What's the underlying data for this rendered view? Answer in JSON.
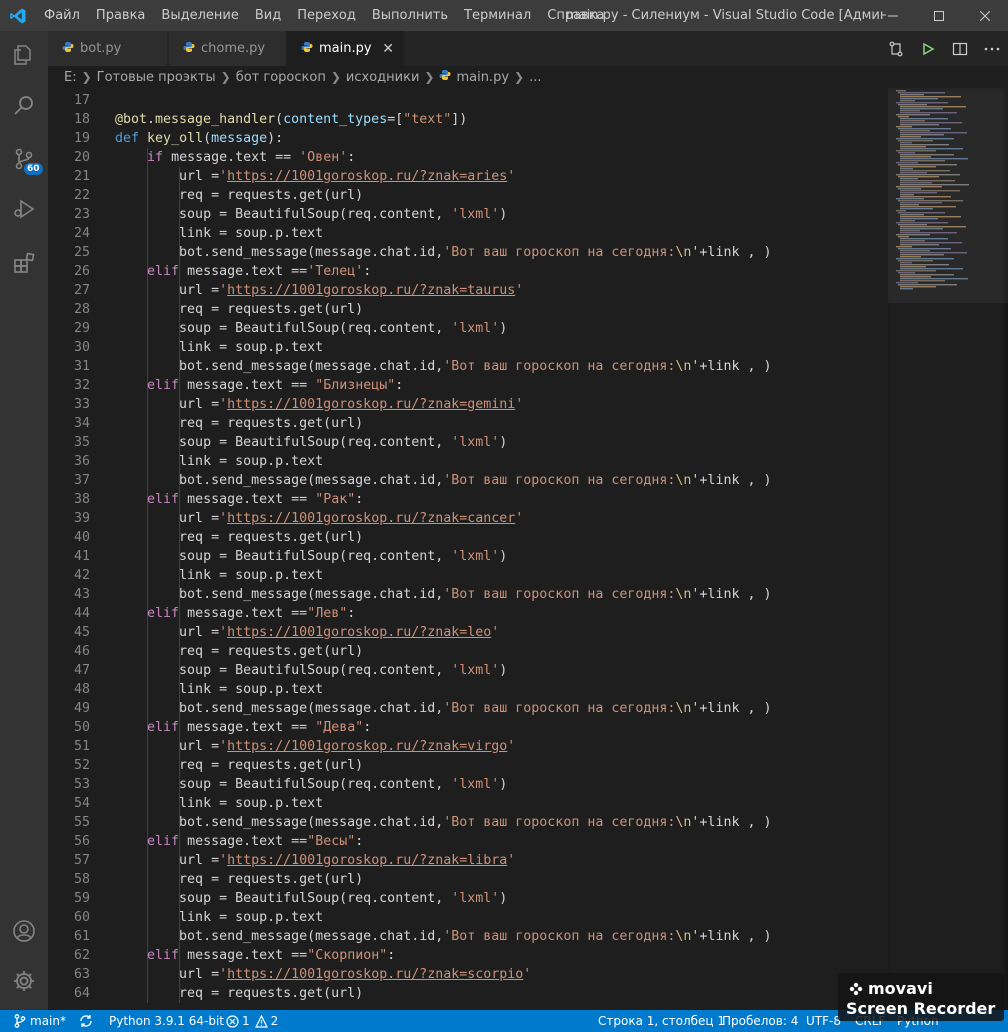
{
  "window": {
    "title": "main.py - Силениум - Visual Studio Code [Администра...",
    "menu": [
      "Файл",
      "Правка",
      "Выделение",
      "Вид",
      "Переход",
      "Выполнить",
      "Терминал",
      "Справка"
    ]
  },
  "activity": {
    "scm_badge": "60"
  },
  "tabs": [
    {
      "label": "bot.py"
    },
    {
      "label": "chome.py"
    },
    {
      "label": "main.py",
      "close": "✕"
    }
  ],
  "breadcrumb": {
    "drive": "E:",
    "folder1": "Готовые проэкты",
    "folder2": "бот гороскоп",
    "folder3": "исходники",
    "file": "main.py",
    "ellipsis": "..."
  },
  "code": {
    "decorator": "@bot.message_handler",
    "decorator_arg": "content_types",
    "decorator_str": "\"text\"",
    "def": "def",
    "funcname": "key_oll",
    "param": "message",
    "if_kw": "if",
    "elif_kw": "elif",
    "cond_prefix": "message.text",
    "url_prefix": "url =",
    "req_line": "req = requests.get(url)",
    "soup_line": "soup = BeautifulSoup(req.content, ",
    "lxml": "'lxml'",
    "link_line": "link = soup.p.text",
    "send_prefix": "bot.send_message(message.chat.id,",
    "send_str": "'Вот ваш гороскоп на сегодня:",
    "send_esc": "\\n",
    "send_tail": "'+link , )",
    "lines": [
      {
        "n": "17"
      },
      {
        "n": "18"
      },
      {
        "n": "19"
      },
      {
        "n": "20"
      },
      {
        "n": "21"
      },
      {
        "n": "22"
      },
      {
        "n": "23"
      },
      {
        "n": "24"
      },
      {
        "n": "25"
      },
      {
        "n": "26"
      },
      {
        "n": "27"
      },
      {
        "n": "28"
      },
      {
        "n": "29"
      },
      {
        "n": "30"
      },
      {
        "n": "31"
      },
      {
        "n": "32"
      },
      {
        "n": "33"
      },
      {
        "n": "34"
      },
      {
        "n": "35"
      },
      {
        "n": "36"
      },
      {
        "n": "37"
      },
      {
        "n": "38"
      },
      {
        "n": "39"
      },
      {
        "n": "40"
      },
      {
        "n": "41"
      },
      {
        "n": "42"
      },
      {
        "n": "43"
      },
      {
        "n": "44"
      },
      {
        "n": "45"
      },
      {
        "n": "46"
      },
      {
        "n": "47"
      },
      {
        "n": "48"
      },
      {
        "n": "49"
      },
      {
        "n": "50"
      },
      {
        "n": "51"
      },
      {
        "n": "52"
      },
      {
        "n": "53"
      },
      {
        "n": "54"
      },
      {
        "n": "55"
      },
      {
        "n": "56"
      },
      {
        "n": "57"
      },
      {
        "n": "58"
      },
      {
        "n": "59"
      },
      {
        "n": "60"
      },
      {
        "n": "61"
      },
      {
        "n": "62"
      },
      {
        "n": "63"
      },
      {
        "n": "64"
      }
    ],
    "blocks": [
      {
        "op": " == ",
        "sign": "'Овен'",
        "url": "https://1001goroskop.ru/?znak=aries"
      },
      {
        "op": " ==",
        "sign": "'Телец'",
        "url": "https://1001goroskop.ru/?znak=taurus"
      },
      {
        "op": " == ",
        "sign": "\"Близнецы\"",
        "url": "https://1001goroskop.ru/?znak=gemini"
      },
      {
        "op": " == ",
        "sign": "\"Рак\"",
        "url": "https://1001goroskop.ru/?znak=cancer"
      },
      {
        "op": " ==",
        "sign": "\"Лев\"",
        "url": "https://1001goroskop.ru/?znak=leo"
      },
      {
        "op": " == ",
        "sign": "\"Дева\"",
        "url": "https://1001goroskop.ru/?znak=virgo"
      },
      {
        "op": " ==",
        "sign": "\"Весы\"",
        "url": "https://1001goroskop.ru/?znak=libra"
      },
      {
        "op": " ==",
        "sign": "\"Скорпион\"",
        "url": "https://1001goroskop.ru/?znak=scorpio"
      }
    ]
  },
  "status": {
    "branch": "main*",
    "python": "Python 3.9.1 64-bit",
    "errors": "1",
    "warnings": "2",
    "position": "Строка 1, столбец 1",
    "spaces": "Пробелов: 4",
    "encoding": "UTF-8",
    "eol": "CRLF",
    "language": "Python"
  },
  "watermark": {
    "brand": "movavi",
    "product": "Screen Recorder"
  },
  "colors": {
    "statusbar": "#007acc",
    "keyword": "#c586c0",
    "string": "#ce9178",
    "function": "#dcdcaa"
  }
}
